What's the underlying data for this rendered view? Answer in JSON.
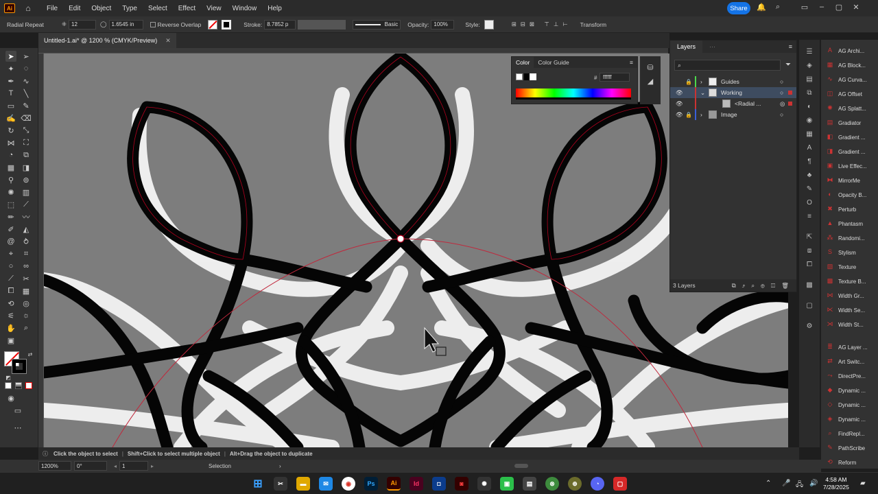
{
  "app": {
    "logo": "Ai",
    "title": "Untitled-1.ai* @ 1200 % (CMYK/Preview)"
  },
  "menu": [
    "File",
    "Edit",
    "Object",
    "Type",
    "Select",
    "Effect",
    "View",
    "Window",
    "Help"
  ],
  "share_label": "Share",
  "control": {
    "tool_name": "Radial Repeat",
    "instances": "12",
    "radius": "1.6545 in",
    "reverse_overlap": "Reverse Overlap",
    "stroke_label": "Stroke:",
    "stroke_value": "8.7852 p",
    "brush": "Basic",
    "opacity_label": "Opacity:",
    "opacity_value": "100%",
    "style_label": "Style:",
    "transform": "Transform"
  },
  "color_panel": {
    "tabs": [
      "Color",
      "Color Guide"
    ],
    "hex_label": "#",
    "hex": "ffffff"
  },
  "layers_panel": {
    "tabs": [
      "Layers",
      "Properties",
      "Libraries"
    ],
    "search_placeholder": "Search All",
    "layers": [
      {
        "name": "Guides",
        "color": "#4cd94c"
      },
      {
        "name": "Working",
        "color": "#cc3333"
      },
      {
        "name": "<Radial ...",
        "color": "#cc3333"
      },
      {
        "name": "Image",
        "color": "#3a5fd9"
      }
    ],
    "count": "3 Layers"
  },
  "plugins": [
    "AG Archi...",
    "AG Block...",
    "AG Curva...",
    "AG Offset",
    "AG Splatt...",
    "Gradiator",
    "Gradient ...",
    "Gradient ...",
    "Live Effec...",
    "MirrorMe",
    "Opacity B...",
    "Perturb",
    "Phantasm",
    "Randomi...",
    "Stylism",
    "Texture",
    "Texture B...",
    "Width Gr...",
    "Width Se...",
    "Width St...",
    "AG Layer ...",
    "Art Switc...",
    "DirectPre...",
    "Dynamic ...",
    "Dynamic ...",
    "Dynamic ...",
    "FindRepl...",
    "PathScribe",
    "Reform"
  ],
  "status": {
    "hint1": "Click the object to select",
    "hint2": "Shift+Click to select multiple object",
    "hint3": "Alt+Drag the object to duplicate"
  },
  "bottom": {
    "zoom": "1200%",
    "rotate": "0°",
    "artboard": "1",
    "mode": "Selection"
  },
  "clock": {
    "time": "4:58 AM",
    "date": "7/28/2025"
  },
  "taskbar_labels": [
    "Ps",
    "Ai",
    "Id"
  ]
}
